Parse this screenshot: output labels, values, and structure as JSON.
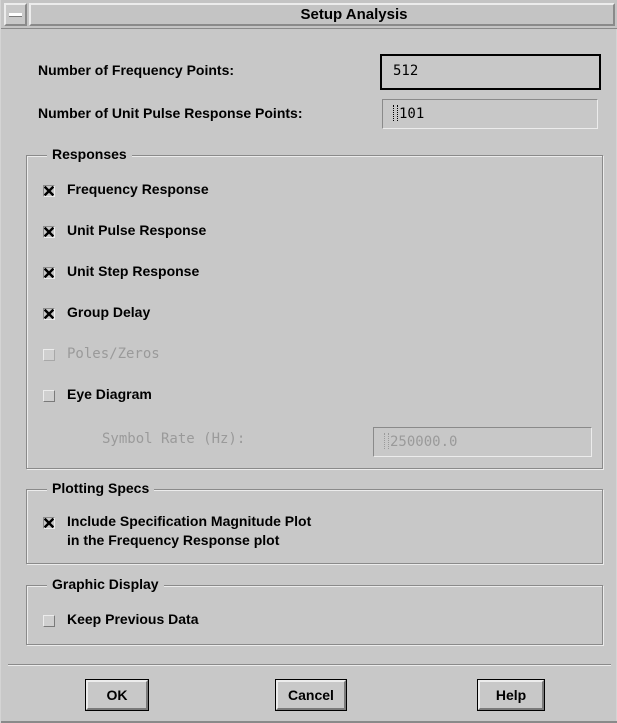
{
  "window": {
    "title": "Setup Analysis",
    "system_menu_icon": "window-menu-icon"
  },
  "fields": {
    "freq_points": {
      "label": "Number of Frequency Points:",
      "value": "512"
    },
    "pulse_points": {
      "label": "Number of Unit Pulse Response Points:",
      "value": "101"
    }
  },
  "responses": {
    "title": "Responses",
    "items": [
      {
        "label": "Frequency Response",
        "checked": true,
        "enabled": true
      },
      {
        "label": "Unit Pulse Response",
        "checked": true,
        "enabled": true
      },
      {
        "label": "Unit Step Response",
        "checked": true,
        "enabled": true
      },
      {
        "label": "Group Delay",
        "checked": true,
        "enabled": true
      },
      {
        "label": "Poles/Zeros",
        "checked": false,
        "enabled": false
      },
      {
        "label": "Eye Diagram",
        "checked": false,
        "enabled": true
      }
    ],
    "symbol_rate": {
      "label": "Symbol Rate (Hz):",
      "value": "250000.0",
      "enabled": false
    }
  },
  "plotting_specs": {
    "title": "Plotting Specs",
    "item": {
      "line1": "Include Specification Magnitude Plot",
      "line2": "in the Frequency Response plot",
      "checked": true
    }
  },
  "graphic_display": {
    "title": "Graphic Display",
    "item": {
      "label": "Keep Previous Data",
      "checked": false
    }
  },
  "buttons": {
    "ok": "OK",
    "cancel": "Cancel",
    "help": "Help"
  }
}
